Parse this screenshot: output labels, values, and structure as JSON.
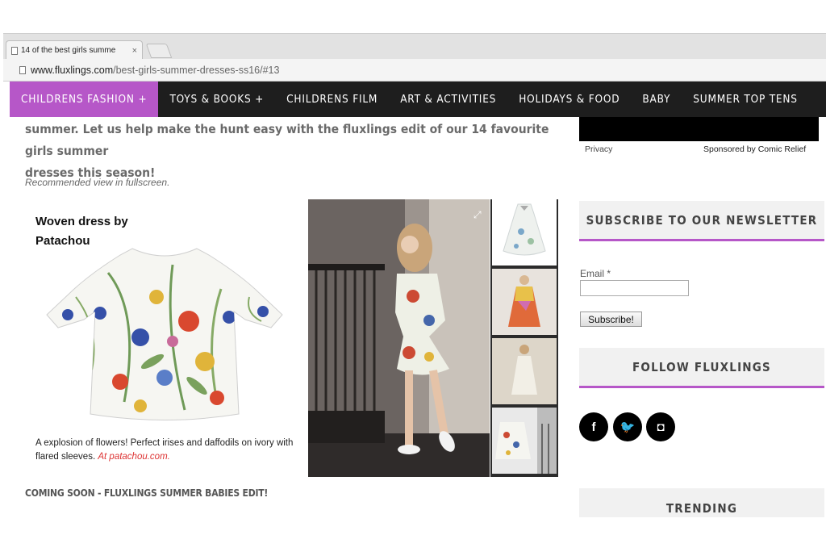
{
  "browser": {
    "tab_title": "14 of the best girls summe",
    "tab_close": "×",
    "url_host": "www.fluxlings.com",
    "url_path": "/best-girls-summer-dresses-ss16/#13"
  },
  "nav": {
    "items": [
      {
        "label": "CHILDRENS FASHION +"
      },
      {
        "label": "TOYS & BOOKS +"
      },
      {
        "label": "CHILDRENS FILM"
      },
      {
        "label": "ART & ACTIVITIES"
      },
      {
        "label": "HOLIDAYS & FOOD"
      },
      {
        "label": "BABY"
      },
      {
        "label": "SUMMER TOP TENS"
      }
    ],
    "accent_color": "#b657c8"
  },
  "main": {
    "intro_line1": "summer. Let us help make the hunt easy with the fluxlings edit of our 14 favourite girls summer",
    "intro_line2": "dresses this season!",
    "recommended_note": "Recommended view in fullscreen.",
    "product": {
      "title_line1": "Woven dress by",
      "title_line2": "Patachou",
      "description": "A explosion of flowers! Perfect irises and daffodils on ivory with flared sleeves.",
      "link_text": "At patachou.com."
    },
    "coming_soon": "COMING SOON - FLUXLINGS SUMMER BABIES EDIT!"
  },
  "sidebar": {
    "ad_privacy": "Privacy",
    "ad_sponsor": "Sponsored by Comic Relief",
    "newsletter_heading": "SUBSCRIBE TO OUR NEWSLETTER",
    "email_label": "Email *",
    "email_value": "",
    "subscribe_label": "Subscribe!",
    "follow_heading": "FOLLOW FLUXLINGS",
    "social": [
      {
        "icon": "facebook-icon",
        "glyph": "f"
      },
      {
        "icon": "twitter-icon",
        "glyph": "🐦"
      },
      {
        "icon": "instagram-icon",
        "glyph": "◘"
      }
    ],
    "trending_heading": "TRENDING"
  }
}
